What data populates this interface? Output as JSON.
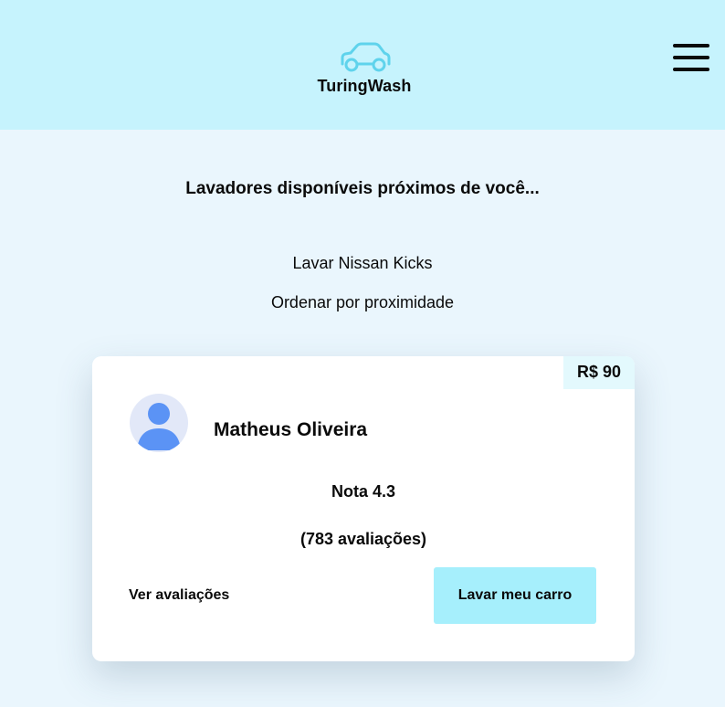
{
  "header": {
    "logo_text": "TuringWash",
    "logo_icon": "car-icon",
    "menu_icon": "hamburger-menu-icon"
  },
  "main": {
    "title": "Lavadores disponíveis próximos de você...",
    "service": "Lavar Nissan Kicks",
    "sort_label": "Ordenar por proximidade"
  },
  "washer_card": {
    "price": "R$ 90",
    "name": "Matheus Oliveira",
    "rating": "Nota 4.3",
    "reviews_count": "(783 avaliações)",
    "reviews_link": "Ver avaliações",
    "wash_button": "Lavar meu carro",
    "avatar_icon": "user-avatar-icon"
  },
  "colors": {
    "header_bg": "#c6f3fd",
    "page_bg": "#eaf6fd",
    "accent_button": "#a6effc",
    "logo_stroke": "#5fd3ec",
    "avatar_fg": "#5b93f5"
  }
}
